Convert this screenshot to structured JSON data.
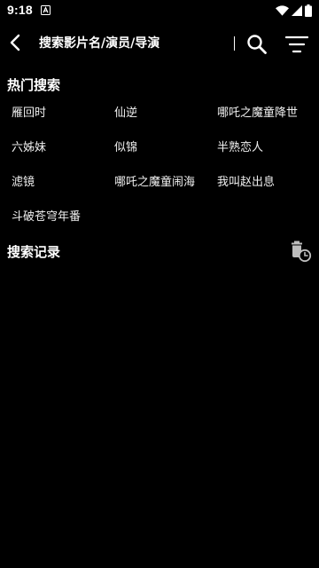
{
  "status_bar": {
    "time": "9:18",
    "app_icon": "a-notification-icon",
    "icons": [
      "wifi-icon",
      "signal-icon",
      "battery-icon"
    ]
  },
  "header": {
    "back_icon": "back-arrow-icon",
    "search_placeholder": "搜索影片名/演员/导演",
    "search_icon": "search-icon",
    "filter_icon": "filter-icon"
  },
  "hot_search": {
    "title": "热门搜索",
    "items": [
      "雁回时",
      "仙逆",
      "哪吒之魔童降世",
      "六姊妹",
      "似锦",
      "半熟恋人",
      "滤镜",
      "哪吒之魔童闹海",
      "我叫赵出息",
      "斗破苍穹年番"
    ]
  },
  "history": {
    "title": "搜索记录",
    "clear_icon": "delete-history-icon"
  },
  "colors": {
    "background": "#000000",
    "text": "#ffffff",
    "item_text": "#f0f0f0"
  }
}
